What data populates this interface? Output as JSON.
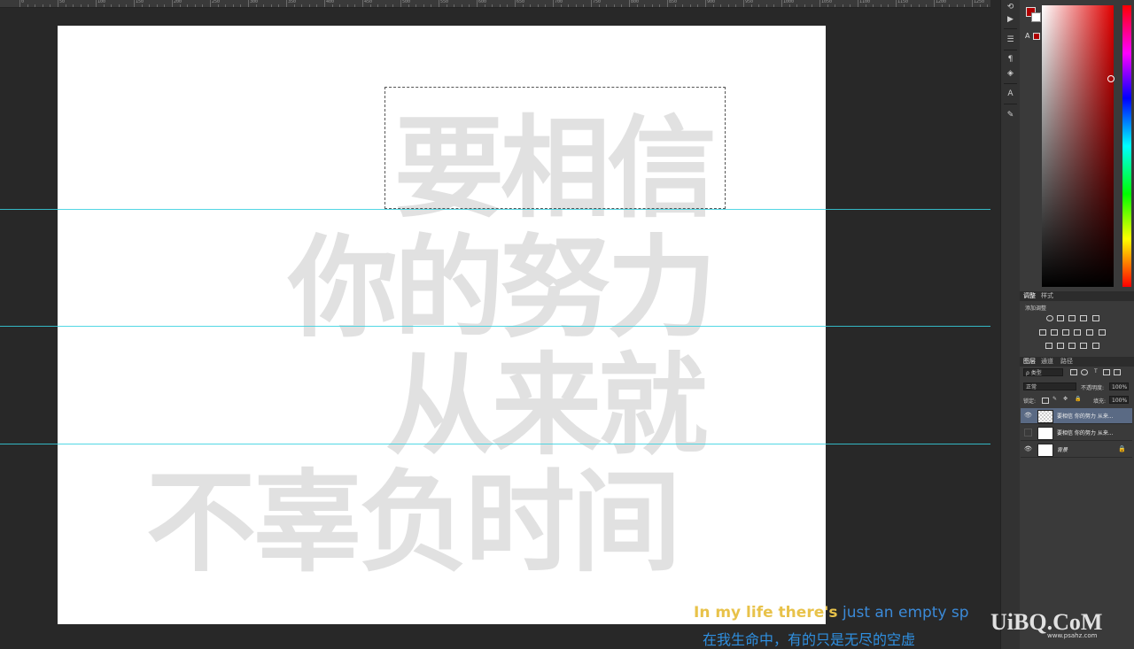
{
  "ruler": {
    "labels": [
      "0",
      "50",
      "100",
      "150",
      "200",
      "250",
      "300",
      "350",
      "400",
      "450",
      "500",
      "550",
      "600",
      "650",
      "700",
      "750",
      "800",
      "850",
      "900",
      "950",
      "1000",
      "1050",
      "1100",
      "1150",
      "1200",
      "1250",
      "1300",
      "1350"
    ]
  },
  "canvas": {
    "lines": [
      "要相信",
      "你的努力",
      "从来就",
      "不辜负时间"
    ]
  },
  "tools": [
    "history-icon",
    "play-icon",
    "adjust-icon",
    "paragraph-icon",
    "layers-icon",
    "character-icon",
    "brush-preset-icon"
  ],
  "color": {
    "foreground": "#b00000",
    "background": "#ffffff",
    "warning_label": "A"
  },
  "adjustments": {
    "tabs": [
      "调整",
      "样式"
    ],
    "title": "添加调整"
  },
  "layers_panel": {
    "tabs": [
      "图层",
      "通道",
      "路径"
    ],
    "filter_kind": "ρ 类型",
    "blend_mode": "正常",
    "opacity_label": "不透明度:",
    "opacity_value": "100%",
    "lock_label": "锁定:",
    "fill_label": "填充:",
    "fill_value": "100%",
    "layers": [
      {
        "name": "要相信 你的努力 从来...",
        "visible": true,
        "selected": true,
        "thumb": "checker"
      },
      {
        "name": "要相信 你的努力 从来...",
        "visible": false,
        "selected": false,
        "thumb": "text"
      },
      {
        "name": "背景",
        "visible": true,
        "selected": false,
        "thumb": "white",
        "locked": true
      }
    ]
  },
  "subtitles": {
    "line1_highlight": "In my life there's",
    "line1_rest": " just an empty sp",
    "line2": "在我生命中，有的只是无尽的空虚"
  },
  "watermark": {
    "text": "UiBQ.CoM",
    "sub": "www.psahz.com"
  }
}
